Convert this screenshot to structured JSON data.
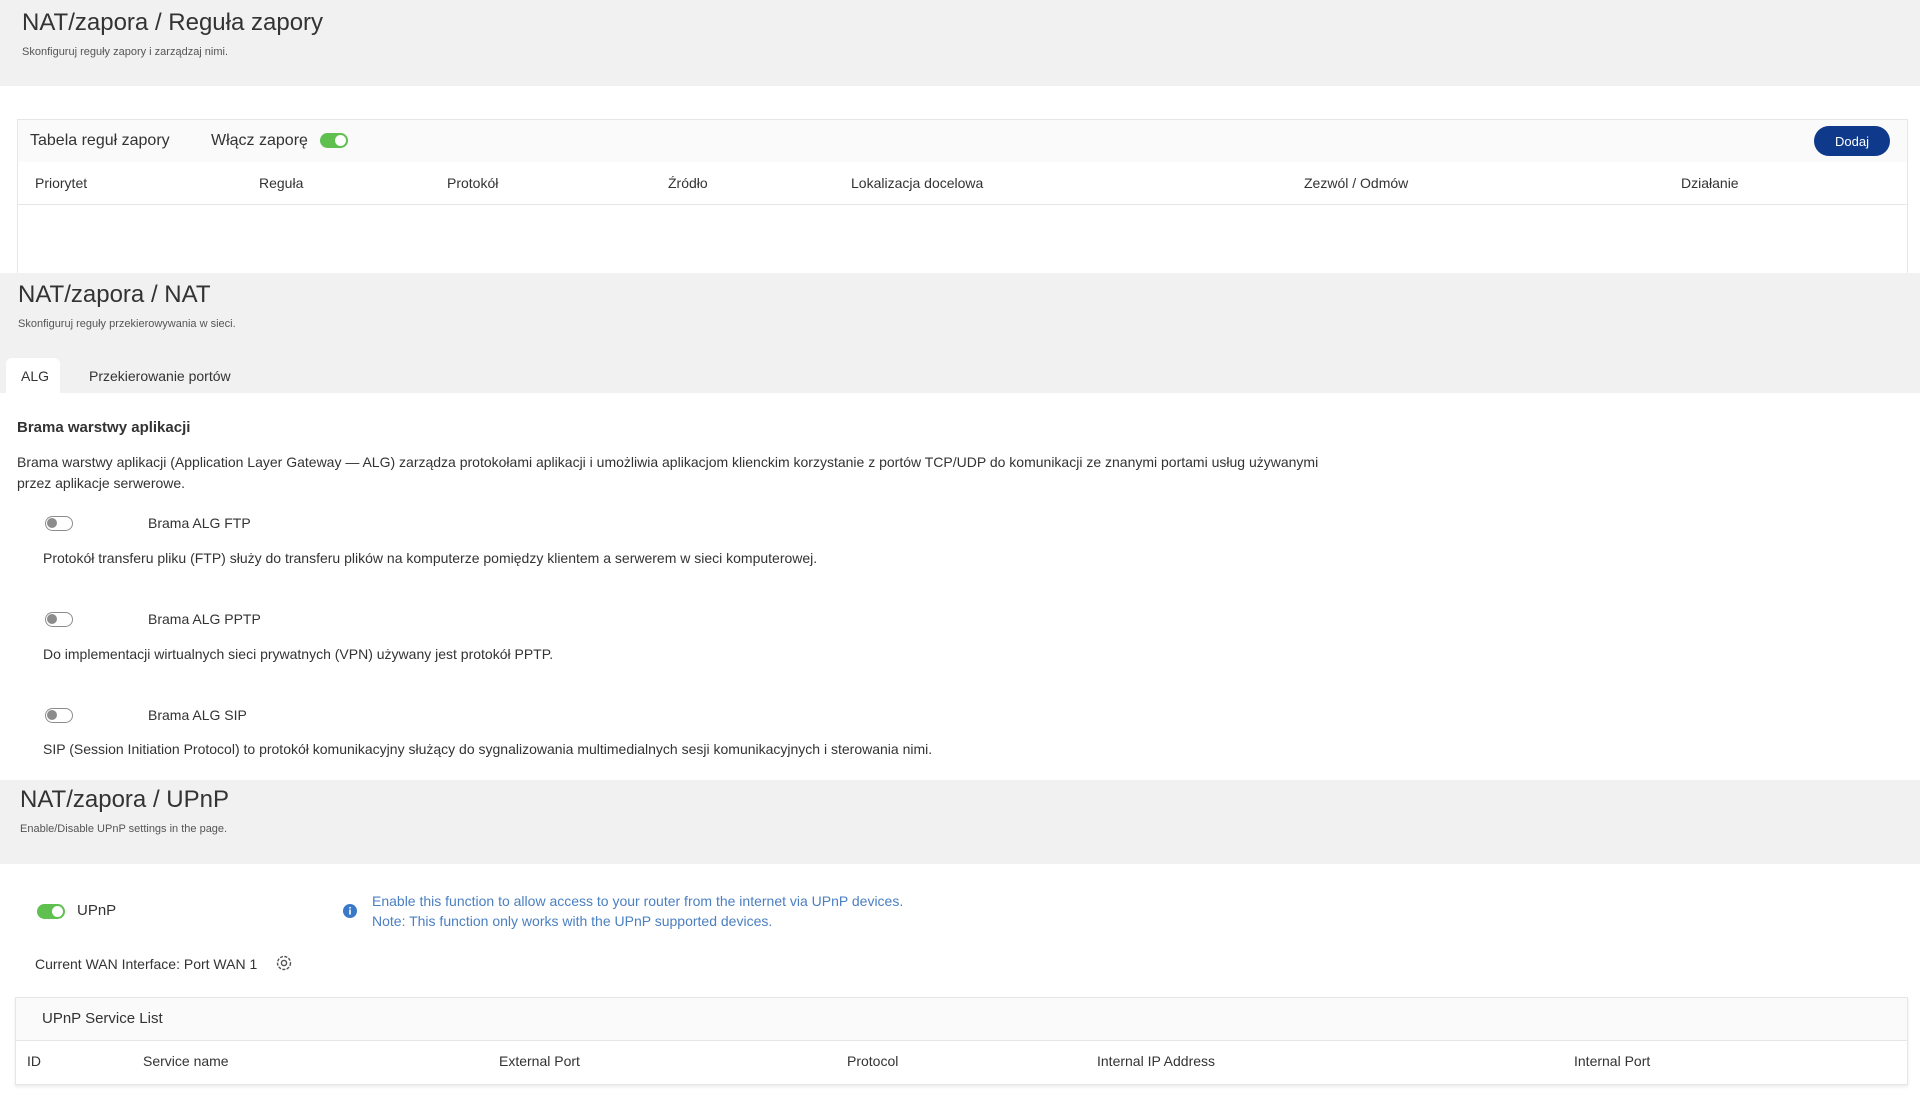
{
  "firewall": {
    "title": "NAT/zapora / Reguła zapory",
    "subtitle": "Skonfiguruj reguły zapory i zarządzaj nimi.",
    "table_title": "Tabela reguł zapory",
    "enable_label": "Włącz zaporę",
    "enable_on": true,
    "add_button": "Dodaj",
    "columns": [
      "Priorytet",
      "Reguła",
      "Protokół",
      "Źródło",
      "Lokalizacja docelowa",
      "Zezwól / Odmów",
      "Działanie"
    ]
  },
  "nat": {
    "title": "NAT/zapora / NAT",
    "subtitle": "Skonfiguruj reguły przekierowywania w sieci.",
    "tabs": [
      {
        "label": "ALG",
        "active": true
      },
      {
        "label": "Przekierowanie portów",
        "active": false
      }
    ],
    "section_title": "Brama warstwy aplikacji",
    "section_desc": "Brama warstwy aplikacji (Application Layer Gateway — ALG) zarządza protokołami aplikacji i umożliwia aplikacjom klienckim korzystanie z portów TCP/UDP do komunikacji ze znanymi portami usług używanymi przez aplikacje serwerowe.",
    "items": [
      {
        "label": "Brama ALG FTP",
        "on": false,
        "desc": "Protokół transferu pliku (FTP) służy do transferu plików na komputerze pomiędzy klientem a serwerem w sieci komputerowej."
      },
      {
        "label": "Brama ALG PPTP",
        "on": false,
        "desc": "Do implementacji wirtualnych sieci prywatnych (VPN) używany jest protokół PPTP."
      },
      {
        "label": "Brama ALG SIP",
        "on": false,
        "desc": "SIP (Session Initiation Protocol) to protokół komunikacyjny służący do sygnalizowania multimedialnych sesji komunikacyjnych i sterowania nimi."
      }
    ]
  },
  "upnp": {
    "title": "NAT/zapora / UPnP",
    "subtitle": "Enable/Disable UPnP settings in the page.",
    "toggle_label": "UPnP",
    "toggle_on": true,
    "info_line1": "Enable this function to allow access to your router from the internet via UPnP devices.",
    "info_line2": "Note: This function only works with the UPnP supported devices.",
    "wan_interface": "Current WAN Interface: Port WAN 1",
    "service_list_title": "UPnP Service List",
    "columns": [
      "ID",
      "Service name",
      "External Port",
      "Protocol",
      "Internal IP Address",
      "Internal Port"
    ]
  },
  "colors": {
    "accent": "#0f3a8c",
    "toggle_on": "#5fbf4f",
    "info_text": "#4a7fc1"
  }
}
